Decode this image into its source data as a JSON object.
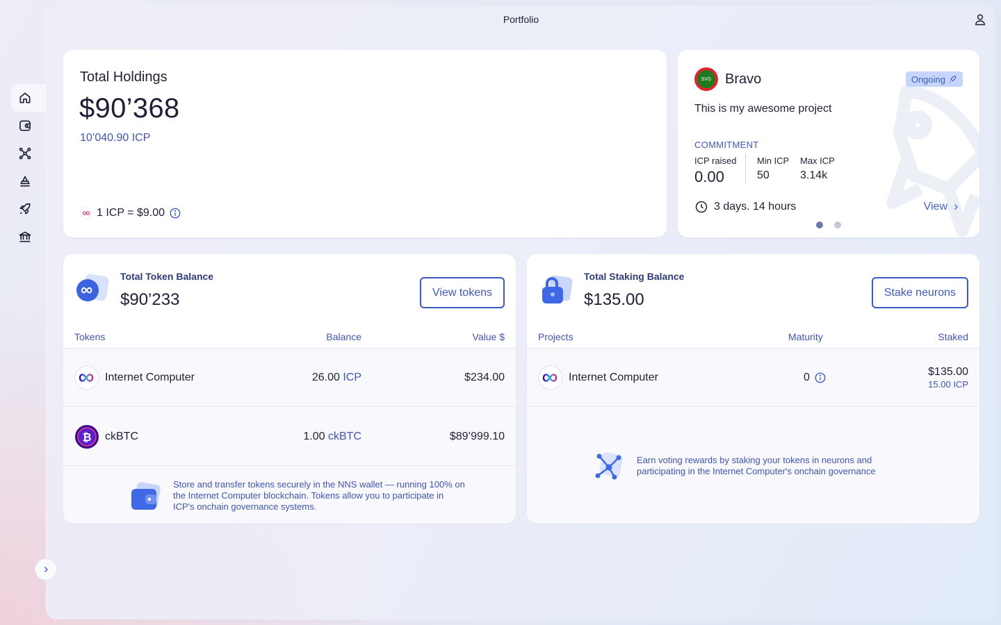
{
  "header": {
    "title": "Portfolio"
  },
  "holdings": {
    "title": "Total Holdings",
    "amount": "$90’368",
    "icp_amount": "10’040.90 ICP",
    "rate": "1 ICP = $9.00"
  },
  "project": {
    "name": "Bravo",
    "logo_text": "SVG",
    "status": "Ongoing",
    "description": "This is my awesome project",
    "commitment_label": "COMMITMENT",
    "icp_raised_label": "ICP raised",
    "icp_raised": "0.00",
    "min_icp_label": "Min ICP",
    "min_icp": "50",
    "max_icp_label": "Max ICP",
    "max_icp": "3.14k",
    "countdown": "3 days. 14 hours",
    "view_label": "View"
  },
  "tokens": {
    "label": "Total Token Balance",
    "value": "$90’233",
    "button": "View tokens",
    "columns": [
      "Tokens",
      "Balance",
      "Value $"
    ],
    "rows": [
      {
        "name": "Internet Computer",
        "balance": "26.00",
        "unit": "ICP",
        "value": "$234.00"
      },
      {
        "name": "ckBTC",
        "balance": "1.00",
        "unit": "ckBTC",
        "value": "$89’999.10"
      }
    ],
    "footer": "Store and transfer tokens securely in the NNS wallet — running 100% on the Internet Computer blockchain. Tokens allow you to participate in ICP's onchain governance systems."
  },
  "staking": {
    "label": "Total Staking Balance",
    "value": "$135.00",
    "button": "Stake neurons",
    "columns": [
      "Projects",
      "Maturity",
      "Staked"
    ],
    "rows": [
      {
        "name": "Internet Computer",
        "maturity": "0",
        "staked_usd": "$135.00",
        "staked_icp": "15.00 ICP"
      }
    ],
    "footer": "Earn voting rewards by staking your tokens in neurons and participating in the Internet Computer's onchain governance"
  },
  "colors": {
    "accent": "#3d57c6",
    "link": "#3f63d9",
    "badge_bg": "#c6d6fb"
  },
  "nav": [
    "home-icon",
    "wallet-icon",
    "neurons-icon",
    "voting-icon",
    "launchpad-icon",
    "canisters-icon"
  ]
}
